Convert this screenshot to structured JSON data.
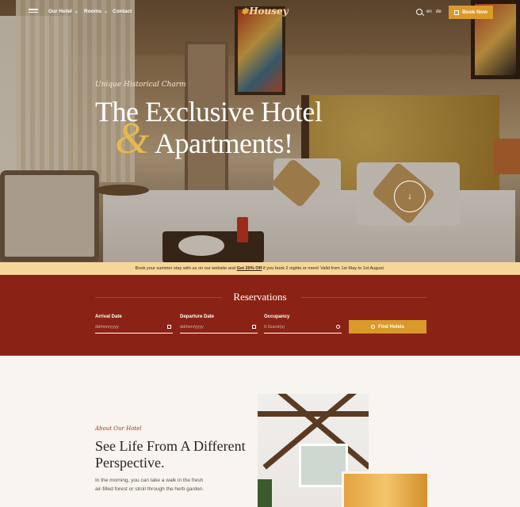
{
  "nav": {
    "items": [
      {
        "label": "Our Hotel",
        "has_dropdown": true
      },
      {
        "label": "Rooms",
        "has_dropdown": true
      },
      {
        "label": "Contact",
        "has_dropdown": false
      }
    ],
    "logo": "Housey",
    "languages": [
      "en",
      "de"
    ],
    "book_now": "Book Now"
  },
  "hero": {
    "eyebrow": "Unique Historical Charm",
    "title_line1": "The Exclusive Hotel",
    "ampersand": "&",
    "title_line2": "Apartments!",
    "scroll_icon": "arrow-down-icon"
  },
  "promo": {
    "before": "Book your summer stay with us on our website and ",
    "highlight": "Get 20% Off",
    "after": " if you book 2 nights or more! Valid from 1st May to 1st August."
  },
  "reservations": {
    "title": "Reservations",
    "arrival": {
      "label": "Arrival Date",
      "placeholder": "dd/mm/yyyy"
    },
    "departure": {
      "label": "Departure Date",
      "placeholder": "dd/mm/yyyy"
    },
    "occupancy": {
      "label": "Occupancy",
      "placeholder": "0 Guest(s)"
    },
    "find_button": "Find Hotels"
  },
  "about": {
    "eyebrow": "About Our Hotel",
    "title": "See Life From A Different Perspective.",
    "text": "In the morning, you can take a walk in the fresh air-filled forest or stroll through the herb garden."
  },
  "colors": {
    "accent": "#d99a2b",
    "reservations_bg": "#8a2315",
    "promo_bg": "#f7d69a",
    "page_bg": "#f8f4ef"
  }
}
